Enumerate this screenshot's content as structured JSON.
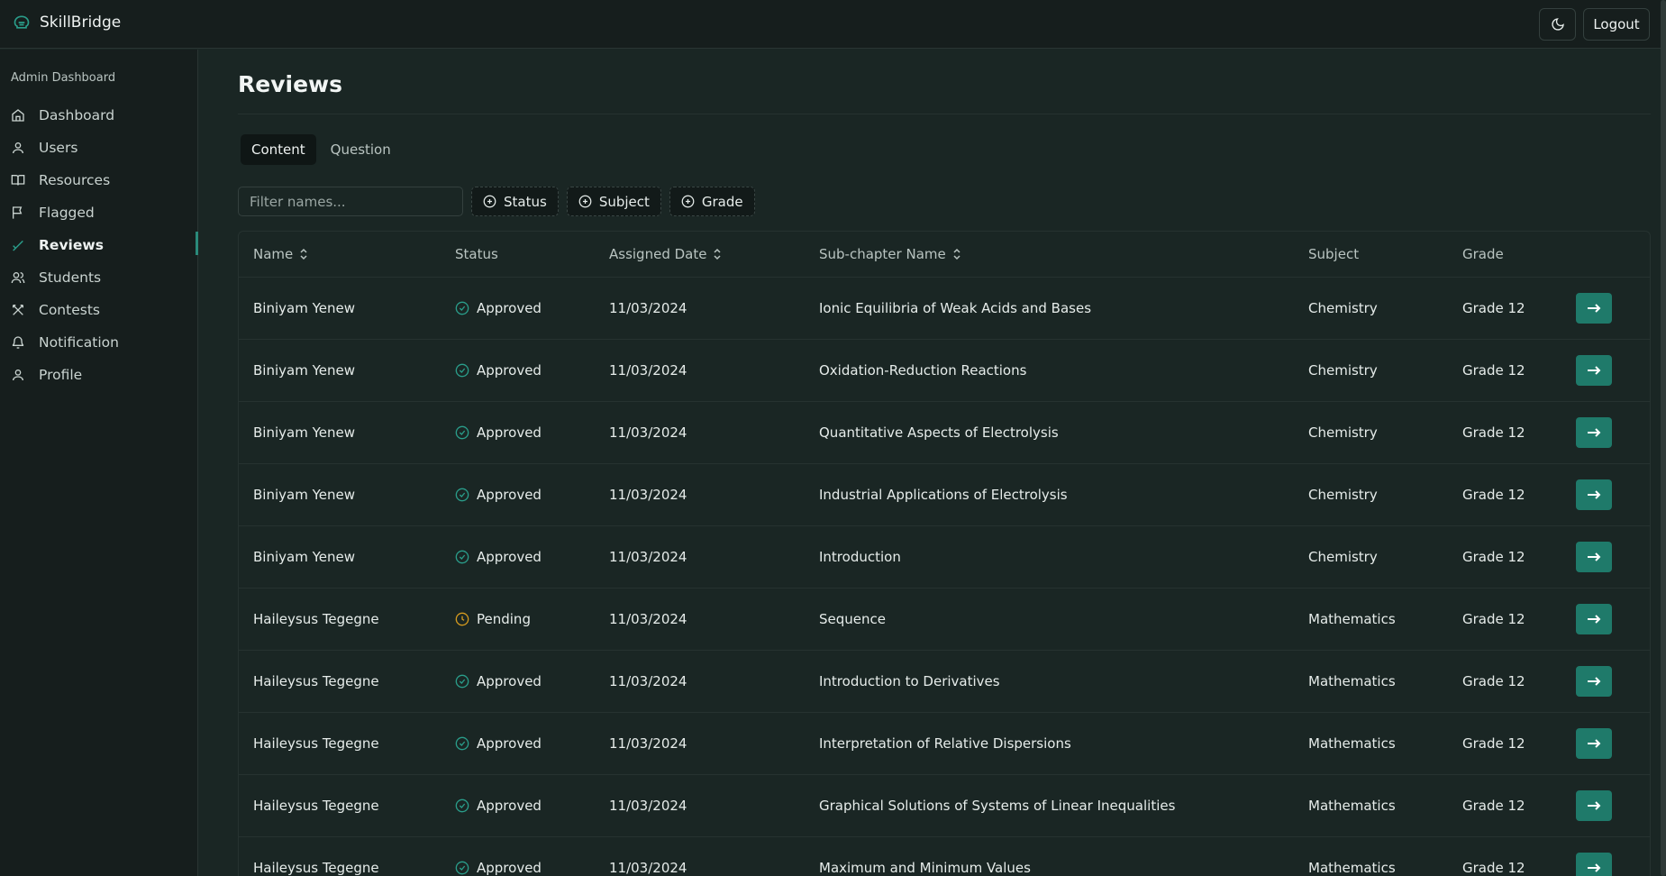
{
  "app": {
    "name": "SkillBridge",
    "logout_label": "Logout"
  },
  "sidebar": {
    "title": "Admin Dashboard",
    "items": [
      {
        "label": "Dashboard",
        "icon": "home-icon"
      },
      {
        "label": "Users",
        "icon": "user-icon"
      },
      {
        "label": "Resources",
        "icon": "book-icon"
      },
      {
        "label": "Flagged",
        "icon": "flag-icon"
      },
      {
        "label": "Reviews",
        "icon": "review-icon",
        "active": true
      },
      {
        "label": "Students",
        "icon": "users-icon"
      },
      {
        "label": "Contests",
        "icon": "swords-icon"
      },
      {
        "label": "Notification",
        "icon": "bell-icon"
      },
      {
        "label": "Profile",
        "icon": "user-icon"
      }
    ]
  },
  "page": {
    "title": "Reviews"
  },
  "tabs": [
    {
      "label": "Content",
      "active": true
    },
    {
      "label": "Question",
      "active": false
    }
  ],
  "filters": {
    "placeholder": "Filter names...",
    "status_label": "Status",
    "subject_label": "Subject",
    "grade_label": "Grade"
  },
  "table": {
    "columns": [
      "Name",
      "Status",
      "Assigned Date",
      "Sub-chapter Name",
      "Subject",
      "Grade"
    ],
    "rows": [
      {
        "name": "Biniyam Yenew",
        "status": "Approved",
        "date": "11/03/2024",
        "subchapter": "Ionic Equilibria of Weak Acids and Bases",
        "subject": "Chemistry",
        "grade": "Grade 12"
      },
      {
        "name": "Biniyam Yenew",
        "status": "Approved",
        "date": "11/03/2024",
        "subchapter": "Oxidation-Reduction Reactions",
        "subject": "Chemistry",
        "grade": "Grade 12"
      },
      {
        "name": "Biniyam Yenew",
        "status": "Approved",
        "date": "11/03/2024",
        "subchapter": "Quantitative Aspects of Electrolysis",
        "subject": "Chemistry",
        "grade": "Grade 12"
      },
      {
        "name": "Biniyam Yenew",
        "status": "Approved",
        "date": "11/03/2024",
        "subchapter": "Industrial Applications of Electrolysis",
        "subject": "Chemistry",
        "grade": "Grade 12"
      },
      {
        "name": "Biniyam Yenew",
        "status": "Approved",
        "date": "11/03/2024",
        "subchapter": "Introduction",
        "subject": "Chemistry",
        "grade": "Grade 12"
      },
      {
        "name": "Haileysus Tegegne",
        "status": "Pending",
        "date": "11/03/2024",
        "subchapter": "Sequence",
        "subject": "Mathematics",
        "grade": "Grade 12"
      },
      {
        "name": "Haileysus Tegegne",
        "status": "Approved",
        "date": "11/03/2024",
        "subchapter": "Introduction to Derivatives",
        "subject": "Mathematics",
        "grade": "Grade 12"
      },
      {
        "name": "Haileysus Tegegne",
        "status": "Approved",
        "date": "11/03/2024",
        "subchapter": "Interpretation of Relative Dispersions",
        "subject": "Mathematics",
        "grade": "Grade 12"
      },
      {
        "name": "Haileysus Tegegne",
        "status": "Approved",
        "date": "11/03/2024",
        "subchapter": "Graphical Solutions of Systems of Linear Inequalities",
        "subject": "Mathematics",
        "grade": "Grade 12"
      },
      {
        "name": "Haileysus Tegegne",
        "status": "Approved",
        "date": "11/03/2024",
        "subchapter": "Maximum and Minimum Values",
        "subject": "Mathematics",
        "grade": "Grade 12"
      }
    ]
  },
  "colors": {
    "accent": "#1f7a6a",
    "approved": "#2a9d8a",
    "pending": "#d49a1f",
    "background": "#1a2624"
  }
}
